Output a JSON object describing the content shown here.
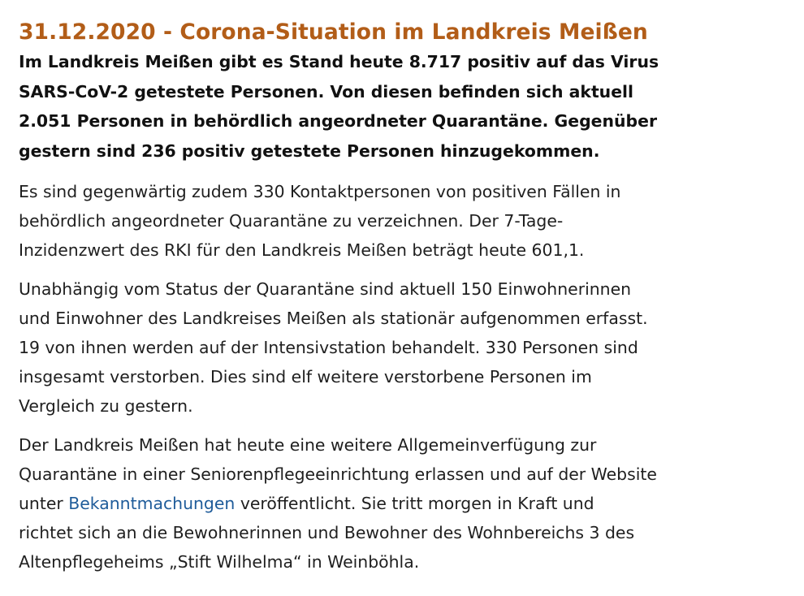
{
  "article": {
    "headline": "31.12.2020 - Corona-Situation im Landkreis Meißen",
    "lead_lines": [
      "Im Landkreis Meißen gibt es Stand heute 8.717 positiv auf das Virus",
      "SARS-CoV-2 getestete Personen. Von diesen befinden sich aktuell",
      "2.051 Personen in behördlich angeordneter Quarantäne. Gegenüber",
      "gestern sind 236 positiv getestete Personen hinzugekommen."
    ],
    "para1_lines": [
      "Es sind gegenwärtig zudem 330 Kontaktpersonen von positiven Fällen in",
      "behördlich angeordneter Quarantäne zu verzeichnen. Der 7-Tage-",
      "Inzidenzwert des RKI für den Landkreis Meißen beträgt heute 601,1."
    ],
    "para2_lines": [
      "Unabhängig vom Status der Quarantäne sind aktuell 150 Einwohnerinnen",
      "und Einwohner des Landkreises Meißen als stationär aufgenommen erfasst.",
      "19 von ihnen werden auf der Intensivstation behandelt. 330 Personen sind",
      "insgesamt verstorben. Dies sind elf weitere verstorbene Personen im",
      "Vergleich zu gestern."
    ],
    "para3": {
      "line1": "Der Landkreis Meißen hat heute eine weitere Allgemeinverfügung zur",
      "line2": "Quarantäne in einer Seniorenpflegeeinrichtung erlassen und auf der Website",
      "line3_before_link": "unter ",
      "link_text": "Bekanntmachungen",
      "line3_after_link": " veröffentlicht. Sie tritt morgen in Kraft und",
      "line4": "richtet sich an die Bewohnerinnen und Bewohner des Wohnbereichs 3 des",
      "line5": "Altenpflegeheims „Stift Wilhelma“ in Weinböhla."
    }
  },
  "colors": {
    "headline": "#b25d18",
    "link": "#1f5c9a",
    "text": "#1f1f1f"
  }
}
